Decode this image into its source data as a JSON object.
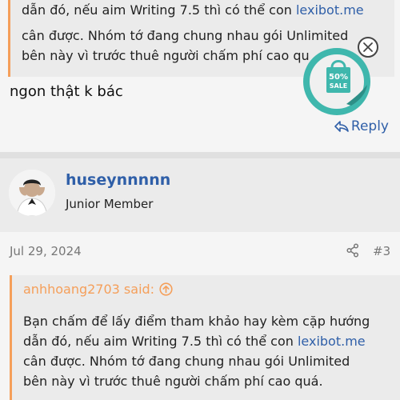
{
  "post1": {
    "quote_lines": [
      {
        "text": "dẫn đó, nếu aim Writing 7.5 thì có thể con ",
        "link": "lexibot.me"
      },
      {
        "text": "cân được. Nhóm tớ đang chung nhau gói Unlimited",
        "link": ""
      },
      {
        "text": "bên này vì trước thuê người chấm phí cao qu",
        "link": ""
      }
    ],
    "message": "ngon thật k bác",
    "reply_label": "Reply"
  },
  "post2": {
    "username": "huseynnnnn",
    "user_title": "Junior Member",
    "date": "Jul 29, 2024",
    "post_number": "#3",
    "quote_attribution": "anhhoang2703 said:",
    "quote_lines": [
      {
        "text": "Bạn chấm để lấy điểm tham khảo hay kèm cặp hướng",
        "link": ""
      },
      {
        "text": "dẫn đó, nếu aim Writing 7.5 thì có thể con ",
        "link": "lexibot.me"
      },
      {
        "text": "cân được. Nhóm tớ đang chung nhau gói Unlimited",
        "link": ""
      },
      {
        "text": "bên này vì trước thuê người chấm phí cao quá.",
        "link": ""
      }
    ]
  },
  "promo": {
    "percent": "50%",
    "sale": "SALE",
    "accent_color": "#3fb7ad"
  },
  "colors": {
    "link": "#2f5fa8",
    "quote_accent": "#f59f5a"
  }
}
